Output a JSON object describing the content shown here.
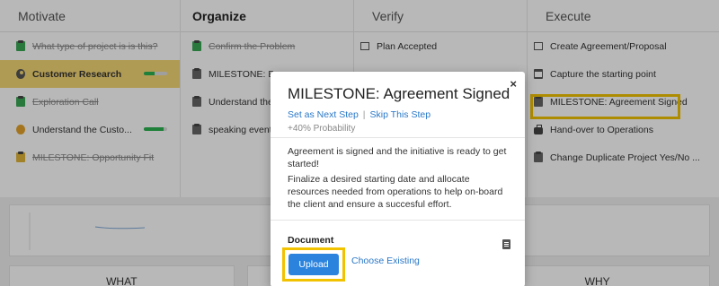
{
  "columns": [
    {
      "title": "Motivate",
      "items": [
        {
          "label": "What type of project is is this?",
          "status": "done",
          "icon": "clipboard-check-icon"
        },
        {
          "label": "Customer Research",
          "status": "active",
          "icon": "person-circle-icon",
          "progress": 0.45
        },
        {
          "label": "Exploration Call",
          "status": "done",
          "icon": "clipboard-check-icon"
        },
        {
          "label": "Understand the Custo...",
          "status": "open",
          "icon": "warning-circle-icon",
          "progress": 0.85
        },
        {
          "label": "MILESTONE: Opportunity Fit",
          "status": "done",
          "icon": "clipboard-milestone-icon"
        }
      ]
    },
    {
      "title": "Organize",
      "items": [
        {
          "label": "Confirm the Problem",
          "status": "done",
          "icon": "clipboard-check-icon"
        },
        {
          "label": "MILESTONE: Buy",
          "status": "open",
          "icon": "clipboard-icon"
        },
        {
          "label": "Understand their",
          "status": "open",
          "icon": "clipboard-icon"
        },
        {
          "label": "speaking event t",
          "status": "open",
          "icon": "clipboard-icon"
        }
      ]
    },
    {
      "title": "Verify",
      "items": [
        {
          "label": "Plan Accepted",
          "status": "open",
          "icon": "checkbox-icon"
        }
      ]
    },
    {
      "title": "Execute",
      "items": [
        {
          "label": "Create Agreement/Proposal",
          "status": "open",
          "icon": "checkbox-icon"
        },
        {
          "label": "Capture the starting point",
          "status": "open",
          "icon": "calendar-icon"
        },
        {
          "label": "MILESTONE: Agreement Signed",
          "status": "open",
          "icon": "document-icon",
          "highlighted": true
        },
        {
          "label": "Hand-over to Operations",
          "status": "open",
          "icon": "briefcase-icon"
        },
        {
          "label": "Change Duplicate Project Yes/No ...",
          "status": "open",
          "icon": "clipboard-icon"
        }
      ]
    }
  ],
  "bottom_cards": [
    "WHAT",
    "",
    "WHY"
  ],
  "modal": {
    "title": "MILESTONE: Agreement Signed",
    "close_label": "×",
    "set_next_step": "Set as Next Step",
    "separator": "|",
    "skip_step": "Skip This Step",
    "probability": "+40% Probability",
    "description_1": "Agreement is signed and the initiative is ready to get started!",
    "description_2": "Finalize a desired starting date and allocate resources needed from operations to help on-board the client and ensure a succesful effort.",
    "document_label": "Document",
    "upload_button": "Upload",
    "choose_existing": "Choose Existing"
  },
  "colors": {
    "active_row": "#f4d776",
    "highlight": "#f2c200",
    "link": "#2a78c8",
    "primary_button": "#2b83de",
    "progress": "#2ab24f"
  }
}
